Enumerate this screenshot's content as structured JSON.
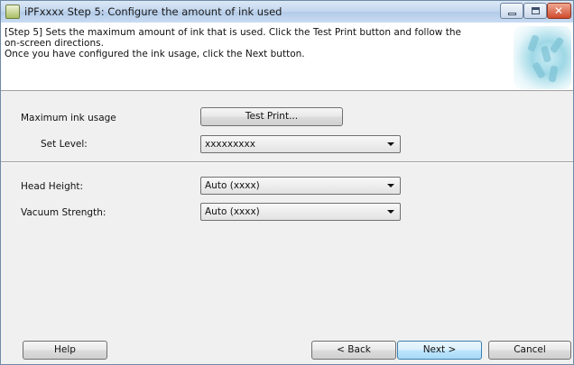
{
  "window": {
    "title": "iPFxxxx Step 5: Configure the amount of ink used"
  },
  "header": {
    "line1": "[Step 5] Sets the maximum amount of ink that is used. Click the Test Print button and follow the",
    "line2": "on-screen directions.",
    "line3": "Once you have configured the ink usage, click the Next button."
  },
  "form": {
    "max_ink_label": "Maximum ink usage",
    "test_print_label": "Test Print...",
    "set_level_label": "Set Level:",
    "set_level_value": "xxxxxxxxx",
    "head_height_label": "Head Height:",
    "head_height_value": "Auto (xxxx)",
    "vacuum_label": "Vacuum Strength:",
    "vacuum_value": "Auto (xxxx)"
  },
  "footer": {
    "help_label": "Help",
    "back_label": "< Back",
    "next_label": "Next >",
    "cancel_label": "Cancel"
  },
  "icons": {
    "app": "printer-app-icon",
    "minimize": "minimize-icon",
    "maximize": "maximize-icon",
    "close": "close-icon",
    "dropdown": "chevron-down-icon"
  },
  "colors": {
    "titlebar": "#c2d6ee",
    "close_button": "#cf4a2e",
    "default_button": "#bee6fd"
  }
}
